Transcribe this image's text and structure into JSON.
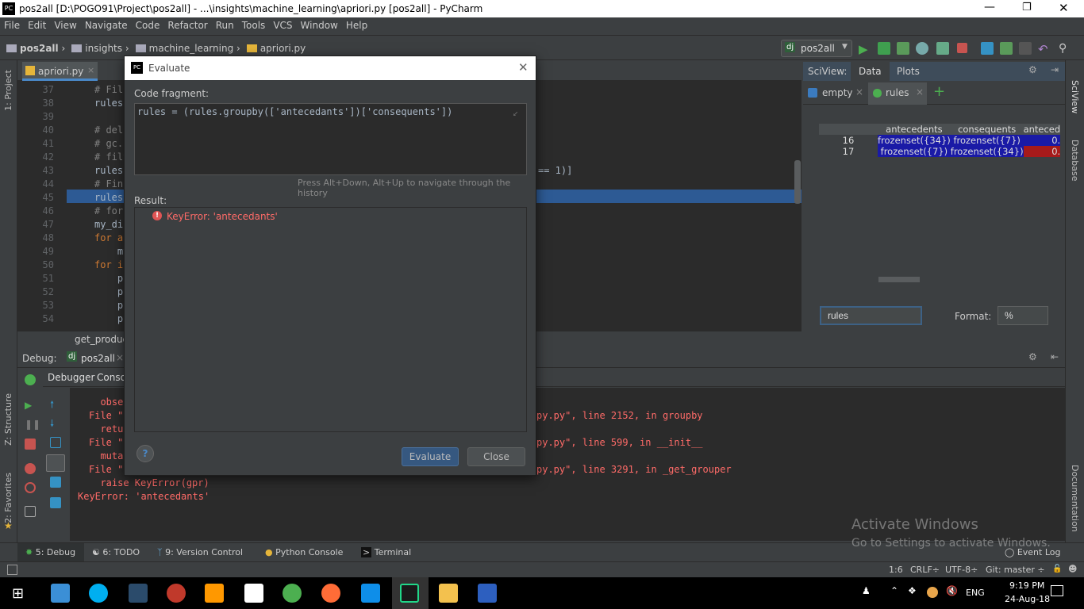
{
  "window": {
    "title": "pos2all [D:\\POGO91\\Project\\pos2all] - ...\\insights\\machine_learning\\apriori.py [pos2all] - PyCharm",
    "app_icon": "PC"
  },
  "menu": [
    "File",
    "Edit",
    "View",
    "Navigate",
    "Code",
    "Refactor",
    "Run",
    "Tools",
    "VCS",
    "Window",
    "Help"
  ],
  "breadcrumbs": [
    "pos2all",
    "insights",
    "machine_learning",
    "apriori.py"
  ],
  "run_config": "pos2all",
  "left_tools": [
    "1: Project",
    "Z: Structure",
    "2: Favorites"
  ],
  "right_tools": [
    "SciView",
    "Database",
    "Documentation"
  ],
  "editor": {
    "tab": "apriori.py",
    "lines": [
      {
        "n": "37",
        "t": "# Fil",
        "c": "cm"
      },
      {
        "n": "38",
        "t": "rules",
        "c": ""
      },
      {
        "n": "39",
        "t": "",
        "c": ""
      },
      {
        "n": "40",
        "t": "# del",
        "c": "cm"
      },
      {
        "n": "41",
        "t": "# gc.",
        "c": "cm"
      },
      {
        "n": "42",
        "t": "# filt",
        "c": "cm"
      },
      {
        "n": "43",
        "t": "rules",
        "c": ""
      },
      {
        "n": "44",
        "t": "# Fin",
        "c": "cm"
      },
      {
        "n": "45",
        "t": "rules",
        "c": ""
      },
      {
        "n": "46",
        "t": "# for",
        "c": "cm"
      },
      {
        "n": "47",
        "t": "my_dic",
        "c": ""
      },
      {
        "n": "48",
        "t": "for an",
        "c": "kw"
      },
      {
        "n": "49",
        "t": "    my",
        "c": ""
      },
      {
        "n": "50",
        "t": "for i",
        "c": "kw"
      },
      {
        "n": "51",
        "t": "    p",
        "c": ""
      },
      {
        "n": "52",
        "t": "    p",
        "c": ""
      },
      {
        "n": "53",
        "t": "    p",
        "c": ""
      },
      {
        "n": "54",
        "t": "    p",
        "c": ""
      }
    ],
    "line43_tail": "== 1)]",
    "breadcrumb_fn": "get_product"
  },
  "sciview": {
    "label": "SciView:",
    "tabs": [
      "Data",
      "Plots"
    ],
    "vars": [
      "empty",
      "rules"
    ],
    "table": {
      "headers": [
        "",
        "antecedents",
        "consequents",
        "anteced"
      ],
      "rows": [
        [
          "16",
          "frozenset({34})",
          "frozenset({7})",
          "0."
        ],
        [
          "17",
          "frozenset({7})",
          "frozenset({34})",
          "0."
        ]
      ],
      "colors": {
        "cell_blue": "#1a1aa6",
        "cell_red": "#a61a1a"
      }
    },
    "var_input": "rules",
    "format_label": "Format:",
    "format_value": "%"
  },
  "debug": {
    "label": "Debug:",
    "config": "pos2all",
    "tabs": [
      "Debugger",
      "Console"
    ],
    "console": [
      {
        "l": "  obse",
        "r": ""
      },
      {
        "l": "File \"",
        "r": "py.py\", line 2152, in groupby",
        "link": "py.py"
      },
      {
        "l": "  retu",
        "r": ""
      },
      {
        "l": "File \"",
        "r": "py.py\", line 599, in __init__"
      },
      {
        "l": "  muta",
        "r": ""
      },
      {
        "l": "File \"",
        "r": "py.py\", line 3291, in _get_grouper"
      },
      {
        "l": "  raise KeyError(gpr)",
        "r": ""
      },
      {
        "l": "KeyError: 'antecedants'",
        "r": ""
      }
    ]
  },
  "dialog": {
    "title": "Evaluate",
    "code_label": "Code fragment:",
    "code": "rules = (rules.groupby(['antecedants'])['consequents'])",
    "hint": "Press Alt+Down, Alt+Up to navigate through the history",
    "result_label": "Result:",
    "result": "KeyError: 'antecedants'",
    "evaluate": "Evaluate",
    "close": "Close",
    "help": "?"
  },
  "bottom_tools": [
    "5: Debug",
    "6: TODO",
    "9: Version Control",
    "Python Console",
    "Terminal"
  ],
  "event_log": "Event Log",
  "status": {
    "pos": "1:6",
    "line_sep": "CRLF÷",
    "encoding": "UTF-8÷",
    "git": "Git: master ÷"
  },
  "watermark": {
    "title": "Activate Windows",
    "sub": "Go to Settings to activate Windows."
  },
  "tray": {
    "lang": "ENG",
    "time": "9:19 PM",
    "date": "24-Aug-18"
  }
}
